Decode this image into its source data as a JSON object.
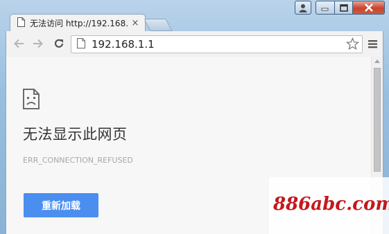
{
  "tab": {
    "title": "无法访问 http://192.168.",
    "close": "×"
  },
  "address_bar": {
    "url": "192.168.1.1"
  },
  "page": {
    "error_title": "无法显示此网页",
    "error_code": "ERR_CONNECTION_REFUSED",
    "reload_label": "重新加载"
  },
  "watermark": {
    "text": "886abc.com"
  },
  "colors": {
    "reload_button": "#4a8ef0",
    "watermark": "#c3181d",
    "close_button": "#c7442c"
  },
  "icons": [
    "page-icon",
    "back-icon",
    "forward-icon",
    "reload-icon",
    "bookmark-star-icon",
    "menu-icon",
    "sad-page-icon",
    "user-icon",
    "minimize-icon",
    "maximize-icon",
    "close-icon"
  ]
}
